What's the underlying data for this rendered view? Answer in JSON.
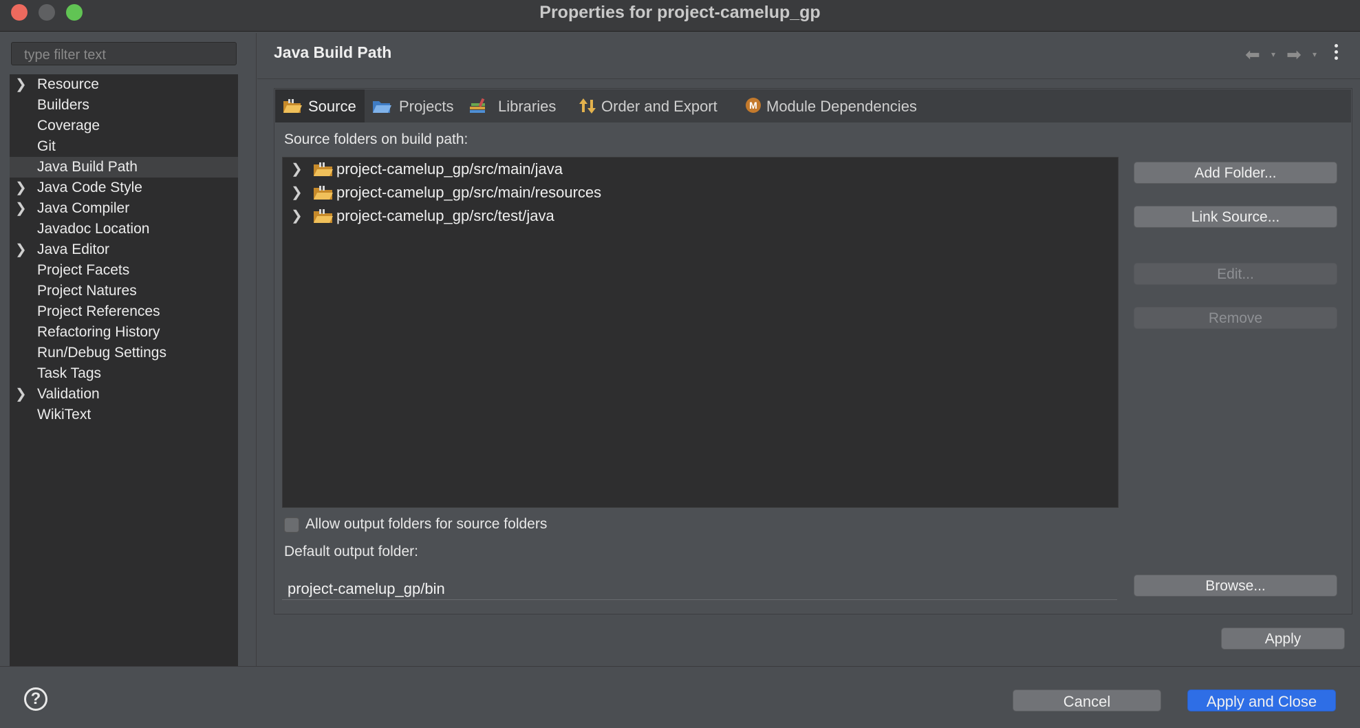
{
  "window": {
    "title": "Properties for project-camelup_gp"
  },
  "sidebar": {
    "filter_placeholder": "type filter text",
    "items": [
      {
        "label": "Resource",
        "expandable": true
      },
      {
        "label": "Builders",
        "expandable": false
      },
      {
        "label": "Coverage",
        "expandable": false
      },
      {
        "label": "Git",
        "expandable": false
      },
      {
        "label": "Java Build Path",
        "expandable": false,
        "selected": true
      },
      {
        "label": "Java Code Style",
        "expandable": true
      },
      {
        "label": "Java Compiler",
        "expandable": true
      },
      {
        "label": "Javadoc Location",
        "expandable": false
      },
      {
        "label": "Java Editor",
        "expandable": true
      },
      {
        "label": "Project Facets",
        "expandable": false
      },
      {
        "label": "Project Natures",
        "expandable": false
      },
      {
        "label": "Project References",
        "expandable": false
      },
      {
        "label": "Refactoring History",
        "expandable": false
      },
      {
        "label": "Run/Debug Settings",
        "expandable": false
      },
      {
        "label": "Task Tags",
        "expandable": false
      },
      {
        "label": "Validation",
        "expandable": true
      },
      {
        "label": "WikiText",
        "expandable": false
      }
    ]
  },
  "page": {
    "title": "Java Build Path"
  },
  "tabs": [
    {
      "label": "Source",
      "icon": "source-folder-icon",
      "active": true
    },
    {
      "label": "Projects",
      "icon": "projects-folder-icon"
    },
    {
      "label": "Libraries",
      "icon": "libraries-icon"
    },
    {
      "label": "Order and Export",
      "icon": "order-export-icon"
    },
    {
      "label": "Module Dependencies",
      "icon": "module-icon"
    }
  ],
  "source": {
    "heading": "Source folders on build path:",
    "folders": [
      "project-camelup_gp/src/main/java",
      "project-camelup_gp/src/main/resources",
      "project-camelup_gp/src/test/java"
    ],
    "buttons": {
      "add_folder": "Add Folder...",
      "link_source": "Link Source...",
      "edit": "Edit...",
      "remove": "Remove",
      "browse": "Browse..."
    },
    "allow_output_label": "Allow output folders for source folders",
    "allow_output_checked": false,
    "default_output_label": "Default output folder:",
    "default_output_value": "project-camelup_gp/bin"
  },
  "footer": {
    "apply": "Apply",
    "cancel": "Cancel",
    "apply_and_close": "Apply and Close",
    "help": "?"
  },
  "colors": {
    "accent": "#2e6ee6",
    "folder": "#e8b04a"
  }
}
